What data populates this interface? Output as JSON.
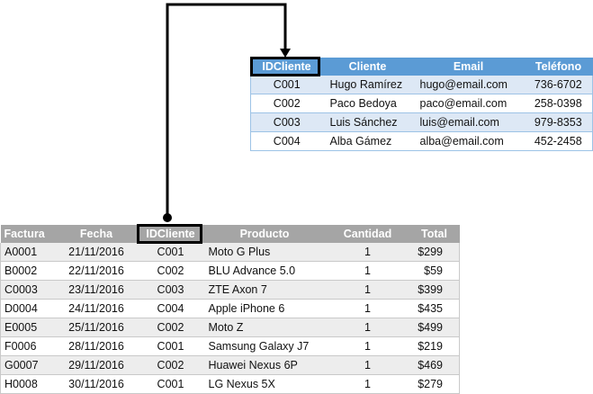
{
  "clients": {
    "headers": [
      "IDCliente",
      "Cliente",
      "Email",
      "Teléfono"
    ],
    "rows": [
      [
        "C001",
        "Hugo Ramírez",
        "hugo@email.com",
        "736-6702"
      ],
      [
        "C002",
        "Paco Bedoya",
        "paco@email.com",
        "258-0398"
      ],
      [
        "C003",
        "Luis Sánchez",
        "luis@email.com",
        "979-8353"
      ],
      [
        "C004",
        "Alba Gámez",
        "alba@email.com",
        "452-2458"
      ]
    ]
  },
  "invoices": {
    "headers": [
      "Factura",
      "Fecha",
      "IDCliente",
      "Producto",
      "Cantidad",
      "Total"
    ],
    "rows": [
      [
        "A0001",
        "21/11/2016",
        "C001",
        "Moto G Plus",
        "1",
        "$299"
      ],
      [
        "B0002",
        "22/11/2016",
        "C002",
        "BLU Advance 5.0",
        "1",
        "$59"
      ],
      [
        "C0003",
        "23/11/2016",
        "C003",
        "ZTE Axon 7",
        "1",
        "$399"
      ],
      [
        "D0004",
        "24/11/2016",
        "C004",
        "Apple iPhone 6",
        "1",
        "$435"
      ],
      [
        "E0005",
        "25/11/2016",
        "C002",
        "Moto Z",
        "1",
        "$499"
      ],
      [
        "F0006",
        "28/11/2016",
        "C001",
        "Samsung Galaxy J7",
        "1",
        "$219"
      ],
      [
        "G0007",
        "29/11/2016",
        "C002",
        "Huawei Nexus 6P",
        "1",
        "$469"
      ],
      [
        "H0008",
        "30/11/2016",
        "C001",
        "LG Nexus 5X",
        "1",
        "$279"
      ]
    ]
  },
  "colors": {
    "clients_header": "#5b9bd5",
    "clients_band": "#dde8f5",
    "invoices_header": "#a5a5a5",
    "invoices_band": "#ededed",
    "connector": "#000000"
  }
}
